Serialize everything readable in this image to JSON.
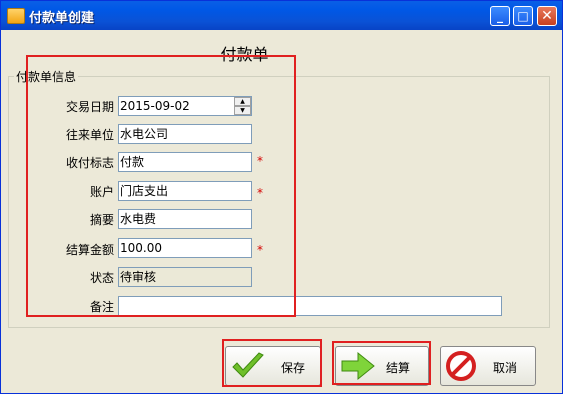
{
  "window": {
    "title": "付款单创建",
    "minimize": "_",
    "maximize": "□",
    "close": "✕"
  },
  "form": {
    "title": "付款单",
    "group_label": "付款单信息",
    "required_mark": "*",
    "fields": {
      "date": {
        "label": "交易日期",
        "value": "2015-09-02"
      },
      "counterparty": {
        "label": "往来单位",
        "value": "水电公司"
      },
      "flag": {
        "label": "收付标志",
        "value": "付款"
      },
      "account": {
        "label": "账户",
        "value": "门店支出"
      },
      "summary": {
        "label": "摘要",
        "value": "水电费"
      },
      "amount": {
        "label": "结算金额",
        "value": "100.00"
      },
      "status": {
        "label": "状态",
        "value": "待审核"
      },
      "remark": {
        "label": "备注",
        "value": ""
      }
    }
  },
  "buttons": {
    "save": "保存",
    "settle": "结算",
    "cancel": "取消"
  },
  "colors": {
    "title_bar": "#0a5fe6",
    "highlight": "#e02020",
    "required": "#d40000"
  }
}
